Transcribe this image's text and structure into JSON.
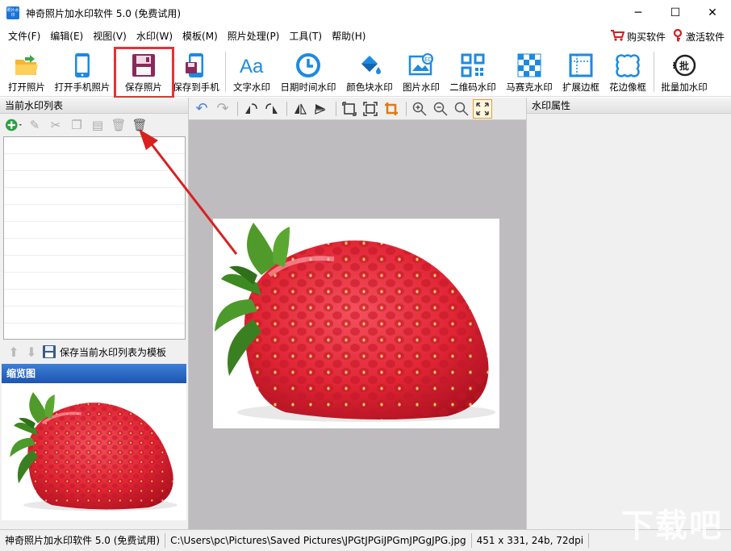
{
  "window": {
    "title": "神奇照片加水印软件 5.0 (免费试用)",
    "app_icon_text": "照片水印",
    "minimize": "─",
    "maximize": "☐",
    "close": "✕"
  },
  "menu": {
    "items": [
      "文件(F)",
      "编辑(E)",
      "视图(V)",
      "水印(W)",
      "模板(M)",
      "照片处理(P)",
      "工具(T)",
      "帮助(H)"
    ],
    "buy": "购买软件",
    "activate": "激活软件"
  },
  "toolbar": {
    "buttons": [
      {
        "label": "打开照片",
        "icon": "folder-open-icon"
      },
      {
        "label": "打开手机照片",
        "icon": "phone-icon"
      },
      {
        "label": "保存照片",
        "icon": "save-icon"
      },
      {
        "label": "保存到手机",
        "icon": "save-to-phone-icon"
      },
      {
        "label": "文字水印",
        "icon": "text-icon"
      },
      {
        "label": "日期时间水印",
        "icon": "clock-icon"
      },
      {
        "label": "颜色块水印",
        "icon": "paint-bucket-icon"
      },
      {
        "label": "图片水印",
        "icon": "image-icon"
      },
      {
        "label": "二维码水印",
        "icon": "qrcode-icon"
      },
      {
        "label": "马赛克水印",
        "icon": "mosaic-icon"
      },
      {
        "label": "扩展边框",
        "icon": "expand-border-icon"
      },
      {
        "label": "花边像框",
        "icon": "frame-icon"
      },
      {
        "label": "批量加水印",
        "icon": "batch-icon"
      }
    ]
  },
  "left_panel": {
    "list_header": "当前水印列表",
    "save_template": "保存当前水印列表为模板",
    "thumbnail_header": "缩览图"
  },
  "right_panel": {
    "header": "水印属性"
  },
  "status": {
    "app": "神奇照片加水印软件 5.0 (免费试用)",
    "path": "C:\\Users\\pc\\Pictures\\Saved Pictures\\JPGtJPGiJPGmJPGgJPG.jpg",
    "info": "451 x 331, 24b, 72dpi"
  },
  "watermark_text": "下载吧"
}
